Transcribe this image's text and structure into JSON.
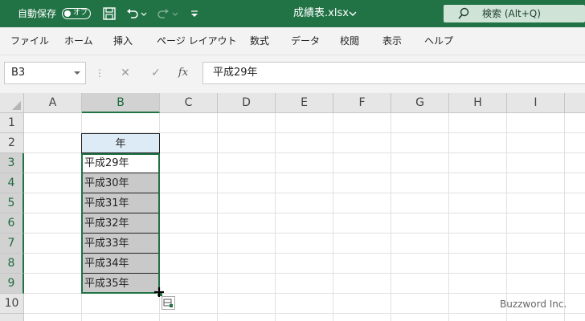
{
  "titlebar": {
    "autosave_label": "自動保存",
    "autosave_state": "オフ",
    "file_name": "成績表.xlsx",
    "search_label": "検索 (Alt+Q)"
  },
  "menu": {
    "items": [
      "ファイル",
      "ホーム",
      "挿入",
      "ページ レイアウト",
      "数式",
      "データ",
      "校閲",
      "表示",
      "ヘルプ"
    ]
  },
  "formula_bar": {
    "name_box": "B3",
    "fx_label": "fx",
    "content": "平成29年"
  },
  "sheet": {
    "columns": [
      "A",
      "B",
      "C",
      "D",
      "E",
      "F",
      "G",
      "H",
      "I"
    ],
    "rows": [
      "1",
      "2",
      "3",
      "4",
      "5",
      "6",
      "7",
      "8",
      "9",
      "10"
    ],
    "header_cell": "年",
    "values": [
      "平成29年",
      "平成30年",
      "平成31年",
      "平成32年",
      "平成33年",
      "平成34年",
      "平成35年"
    ],
    "active_cell": "B3"
  },
  "watermark": "Buzzword Inc.",
  "colors": {
    "accent": "#217346",
    "header_fill": "#ddebf7",
    "selection_fill": "#c9c9c9"
  }
}
